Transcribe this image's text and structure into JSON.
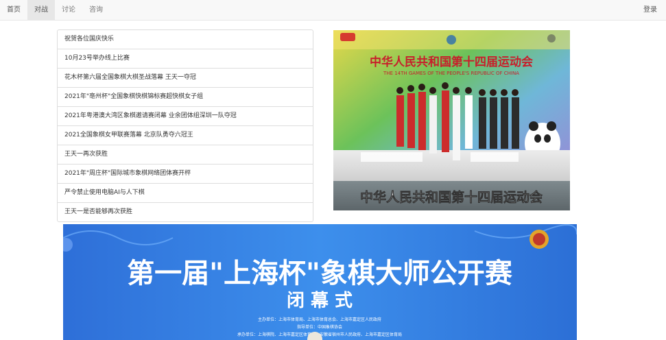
{
  "nav": {
    "items": [
      {
        "label": "首页"
      },
      {
        "label": "对战"
      },
      {
        "label": "讨论"
      },
      {
        "label": "咨询"
      }
    ],
    "login": "登录"
  },
  "news": [
    "祝贺各位国庆快乐",
    "10月23号举办线上比赛",
    "花木杯第六届全国象棋大棋圣战落幕 王天一夺冠",
    "2021年\"亳州杯\"全国象棋快棋锦标赛超快棋女子组",
    "2021年粤港澳大湾区象棋邀请赛闭幕 业余团体组深圳一队夺冠",
    "2021全国象棋女甲联赛落幕 北京队勇夺六冠王",
    "王天一再次获胜",
    "2021年\"周庄杯\"国际城市象棋网络团体赛开枰",
    "严令禁止使用电脑AI与人下棋",
    "王天一是否能够再次获胜"
  ],
  "photo1": {
    "banner_title": "中华人民共和国第十四届运动会",
    "banner_subtitle": "THE 14TH GAMES OF THE PEOPLE'S REPUBLIC OF CHINA",
    "caption": "中华人民共和国第十四届运动会",
    "accent": "#c81e2b"
  },
  "photo2": {
    "title": "第一届\"上海杯\"象棋大师公开赛",
    "subtitle": "闭 幕 式",
    "line1": "主办单位：上海市体育局、上海市体育总会、上海市嘉定区人民政府",
    "line2": "指导单位：中国象棋协会",
    "line3": "承办单位：上海棋院、上海市嘉定区体育局、安徽省宿州市人民政府、上海市嘉定区体育局",
    "bg": "#2f7fe0"
  }
}
